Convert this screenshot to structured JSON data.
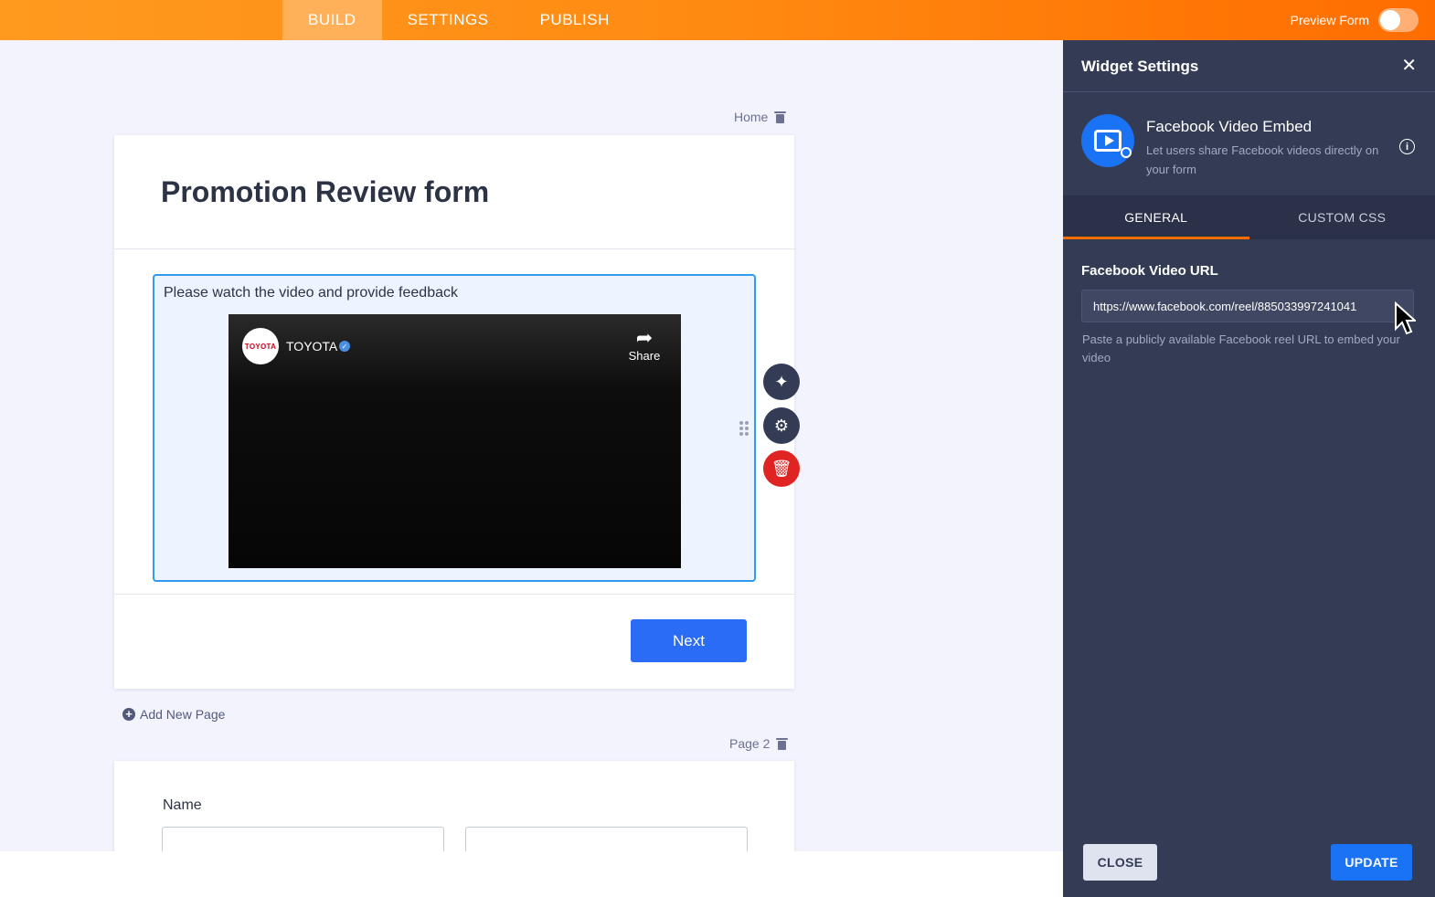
{
  "topbar": {
    "tabs": [
      "BUILD",
      "SETTINGS",
      "PUBLISH"
    ],
    "active_tab": "BUILD",
    "preview_label": "Preview Form",
    "preview_enabled": false
  },
  "form": {
    "page1": {
      "label": "Home",
      "title": "Promotion Review form",
      "video_field": {
        "label": "Please watch the video and provide feedback",
        "channel_logo_text": "TOYOTA",
        "channel_name": "TOYOTA",
        "share_label": "Share"
      },
      "next_button": "Next"
    },
    "add_page_label": "Add New Page",
    "page2": {
      "label": "Page 2",
      "name_label": "Name"
    }
  },
  "panel": {
    "title": "Widget Settings",
    "widget": {
      "name": "Facebook Video Embed",
      "description": "Let users share Facebook videos directly on your form"
    },
    "tabs": [
      "GENERAL",
      "CUSTOM CSS"
    ],
    "active_tab": "GENERAL",
    "url_field": {
      "label": "Facebook Video URL",
      "value": "https://www.facebook.com/reel/885033997241041",
      "help": "Paste a publicly available Facebook reel URL to embed your video"
    },
    "close_button": "CLOSE",
    "update_button": "UPDATE"
  },
  "colors": {
    "accent_orange": "#ff6d00",
    "primary_blue": "#2b6cf6",
    "panel_bg": "#343c55",
    "delete_red": "#e02424"
  }
}
